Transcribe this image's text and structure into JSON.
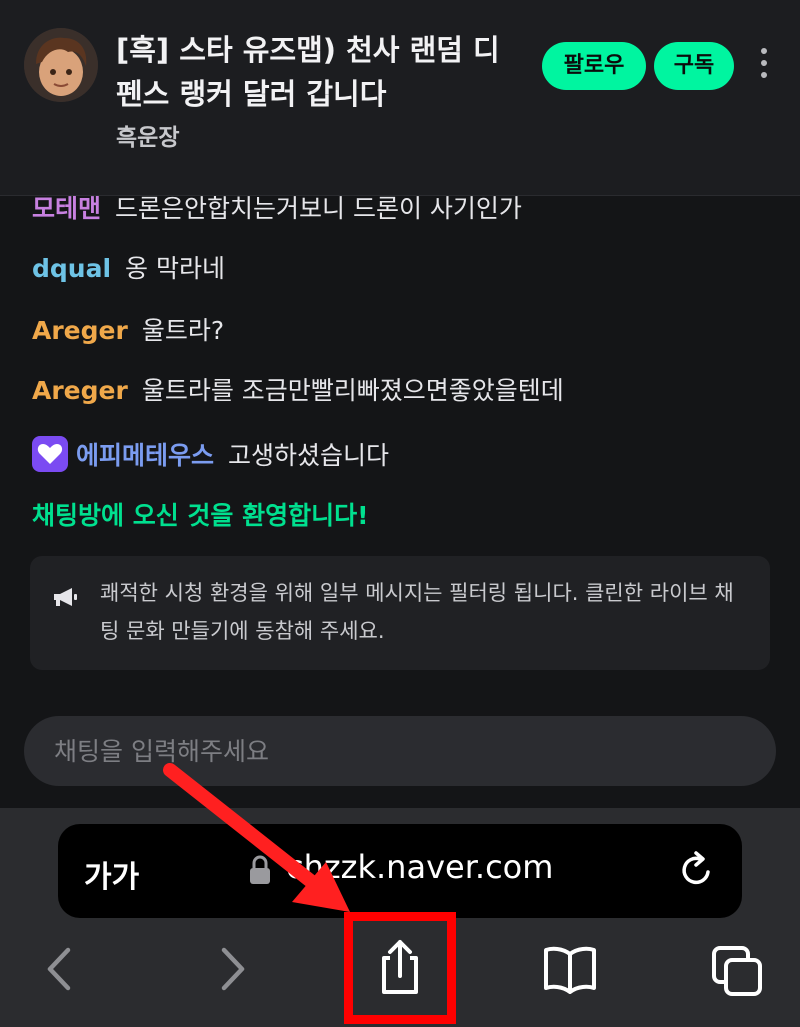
{
  "stream": {
    "title": "[흑] 스타 유즈맵) 천사 랜덤 디펜스 랭커 달러 갑니다",
    "channel": "흑운장",
    "follow_label": "팔로우",
    "subscribe_label": "구독"
  },
  "chat": {
    "messages": [
      {
        "nick": "모테맨",
        "nick_color": "#c780e0",
        "text": "드론은안합치는거보니 드론이 사기인가"
      },
      {
        "nick": "dqual",
        "nick_color": "#6ec3e6",
        "text": "옹 막라네"
      },
      {
        "nick": "Areger",
        "nick_color": "#f0a84a",
        "text": "울트라?"
      },
      {
        "nick": "Areger",
        "nick_color": "#f0a84a",
        "text": "울트라를 조금만빨리빠졌으면좋았을텐데"
      },
      {
        "nick": "에피메테우스",
        "nick_color": "#7b9cf0",
        "text": "고생하셨습니다",
        "badge": "heart-badge-icon"
      }
    ],
    "welcome": "채팅방에 오신 것을 환영합니다!",
    "notice": "쾌적한 시청 환경을 위해 일부 메시지는 필터링 됩니다. 클린한 라이브 채팅 문화 만들기에 동참해 주세요.",
    "input_placeholder": "채팅을 입력해주세요"
  },
  "browser": {
    "text_size_label": "가가",
    "url": "chzzk.naver.com"
  },
  "colors": {
    "accent": "#00f5a0",
    "highlight": "#ff0000"
  }
}
